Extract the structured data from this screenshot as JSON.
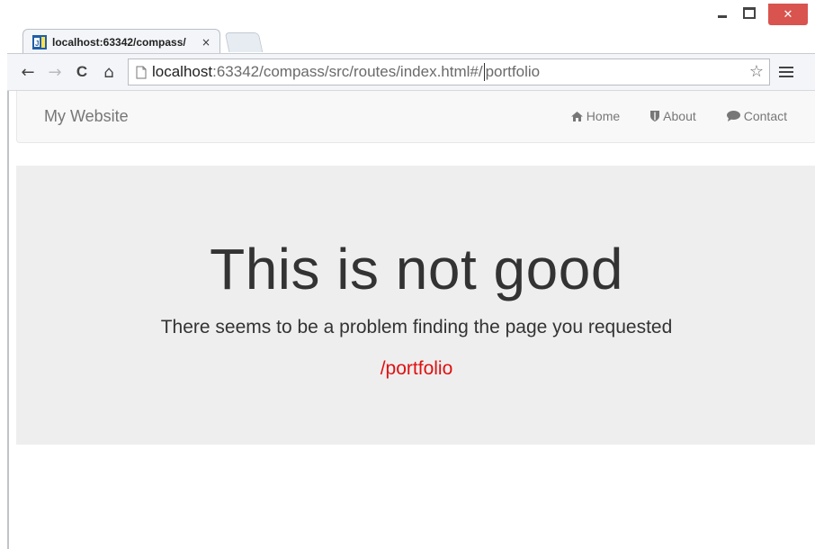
{
  "browser": {
    "tab": {
      "title": "localhost:63342/compass/",
      "close_glyph": "×",
      "favicon": "webstorm-icon"
    },
    "window_controls": {
      "close_glyph": "✕"
    },
    "toolbar": {
      "back_glyph": "←",
      "forward_glyph": "→",
      "reload_glyph": "C",
      "home_glyph": "⌂",
      "url_host": "localhost",
      "url_before_caret": ":63342/compass/src/routes/index.html#/",
      "url_after_caret": "portfolio",
      "star_glyph": "☆"
    }
  },
  "navbar": {
    "brand": "My Website",
    "links": [
      {
        "label": "Home",
        "icon": "home-icon"
      },
      {
        "label": "About",
        "icon": "shield-icon"
      },
      {
        "label": "Contact",
        "icon": "comment-icon"
      }
    ]
  },
  "error": {
    "headline": "This is not good",
    "message": "There seems to be a problem finding the page you requested",
    "path": "/portfolio"
  },
  "colors": {
    "path_text": "#e01010",
    "close_button": "#d9534f",
    "jumbotron_bg": "#eeeeee",
    "navbar_bg": "#f8f8f8"
  }
}
